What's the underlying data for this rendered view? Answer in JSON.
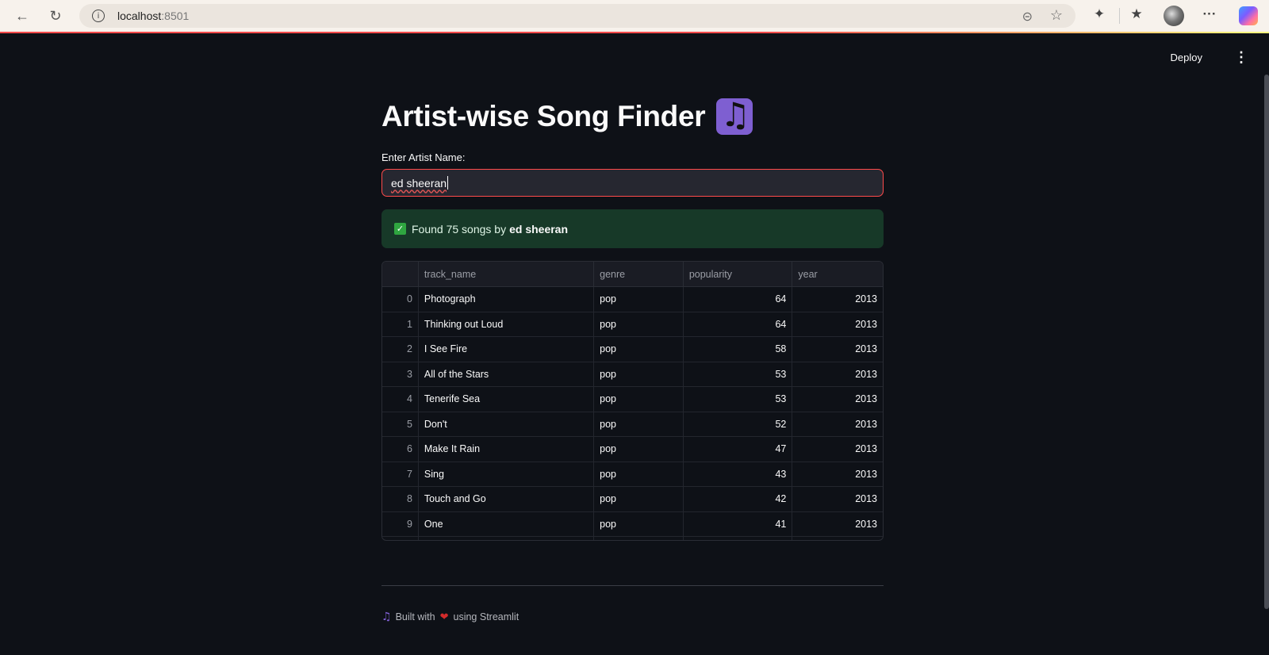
{
  "browser": {
    "url_host": "localhost",
    "url_port": ":8501"
  },
  "app": {
    "deploy_label": "Deploy",
    "title": "Artist-wise Song Finder",
    "input_label": "Enter Artist Name:",
    "input_value": "ed sheeran",
    "alert_prefix": "Found 75 songs by",
    "alert_artist": "ed sheeran",
    "footer_left": "Built with",
    "footer_right": "using Streamlit"
  },
  "table": {
    "columns": [
      "",
      "track_name",
      "genre",
      "popularity",
      "year"
    ],
    "rows": [
      {
        "idx": "0",
        "track": "Photograph",
        "genre": "pop",
        "popularity": "64",
        "year": "2013"
      },
      {
        "idx": "1",
        "track": "Thinking out Loud",
        "genre": "pop",
        "popularity": "64",
        "year": "2013"
      },
      {
        "idx": "2",
        "track": "I See Fire",
        "genre": "pop",
        "popularity": "58",
        "year": "2013"
      },
      {
        "idx": "3",
        "track": "All of the Stars",
        "genre": "pop",
        "popularity": "53",
        "year": "2013"
      },
      {
        "idx": "4",
        "track": "Tenerife Sea",
        "genre": "pop",
        "popularity": "53",
        "year": "2013"
      },
      {
        "idx": "5",
        "track": "Don't",
        "genre": "pop",
        "popularity": "52",
        "year": "2013"
      },
      {
        "idx": "6",
        "track": "Make It Rain",
        "genre": "pop",
        "popularity": "47",
        "year": "2013"
      },
      {
        "idx": "7",
        "track": "Sing",
        "genre": "pop",
        "popularity": "43",
        "year": "2013"
      },
      {
        "idx": "8",
        "track": "Touch and Go",
        "genre": "pop",
        "popularity": "42",
        "year": "2013"
      },
      {
        "idx": "9",
        "track": "One",
        "genre": "pop",
        "popularity": "41",
        "year": "2013"
      }
    ]
  },
  "icons": {
    "back": "arrow-left-icon",
    "reload": "reload-icon",
    "info": "info-icon",
    "zoom": "zoom-out-icon",
    "favorite": "star-icon",
    "extensions": "puzzle-icon",
    "favorites_bar": "favorites-icon",
    "more": "ellipsis-icon",
    "title_emoji": "musical-notes-icon",
    "check": "check-icon",
    "heart": "heart-icon"
  },
  "colors": {
    "background": "#0e1117",
    "accent": "#ff4b4b",
    "success_bg": "#173928",
    "note_purple": "#7e5fd1"
  }
}
